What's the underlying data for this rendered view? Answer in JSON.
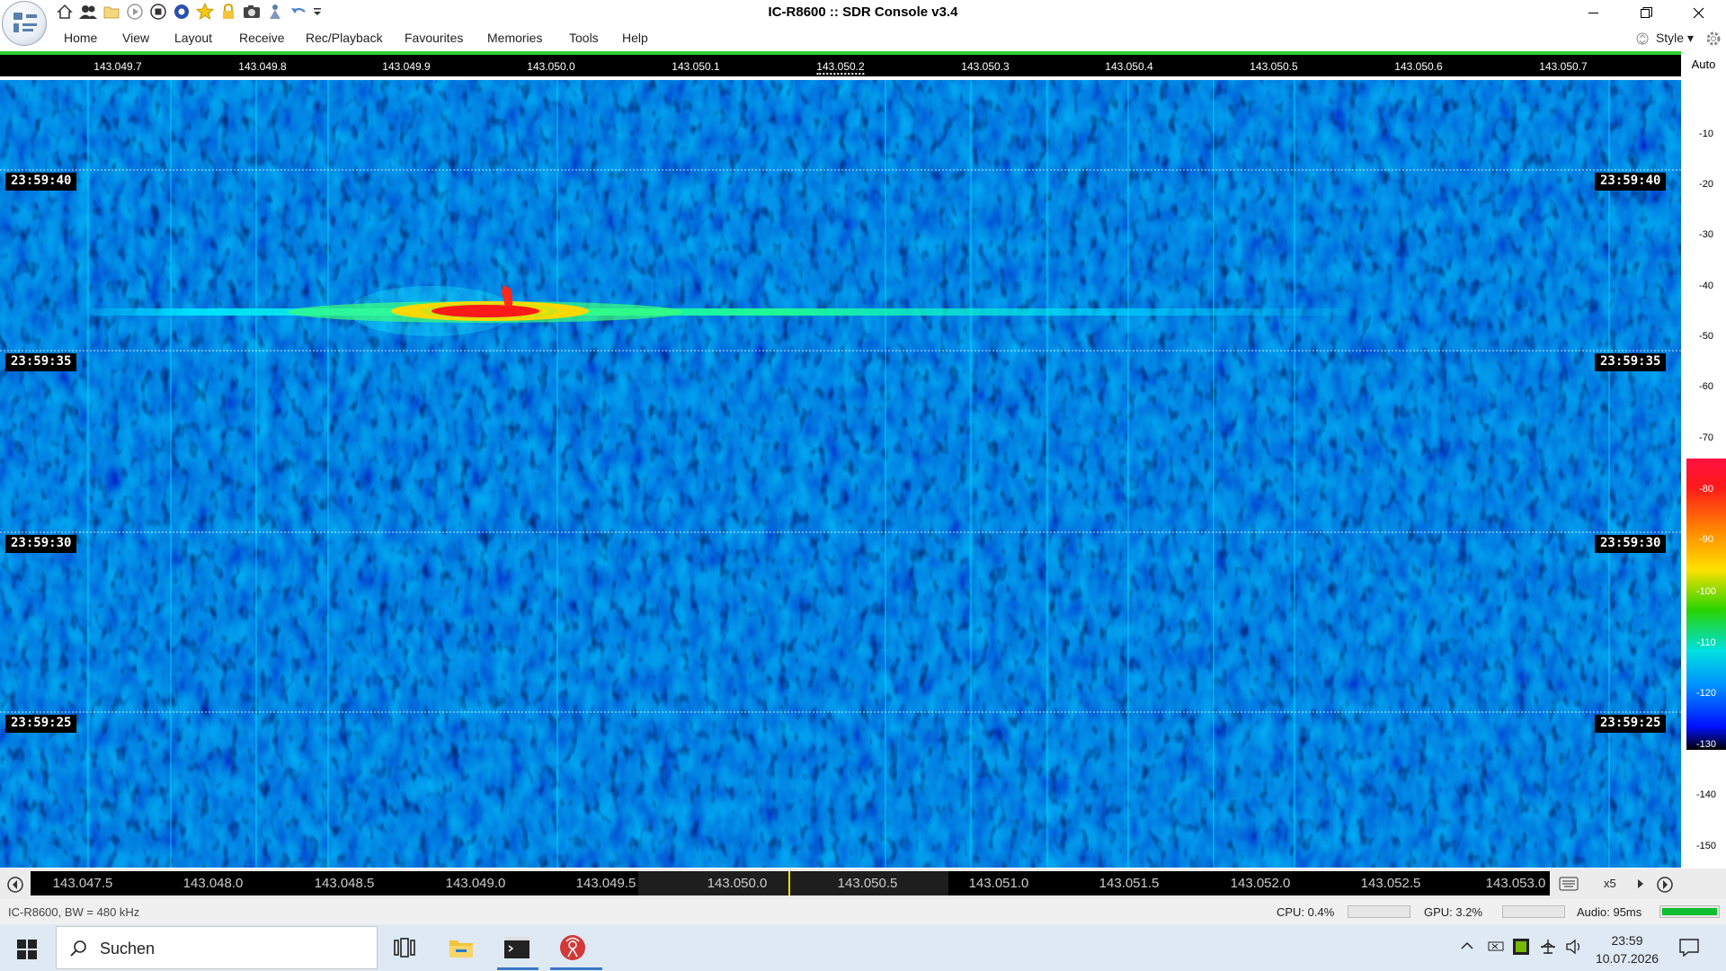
{
  "window": {
    "title": "IC-R8600 :: SDR Console v3.4"
  },
  "menu": {
    "items": [
      "Home",
      "View",
      "Layout",
      "Receive",
      "Rec/Playback",
      "Favourites",
      "Memories",
      "Tools",
      "Help"
    ],
    "style_label": "Style"
  },
  "quick_access": [
    "home-icon",
    "users-icon",
    "open-folder-icon",
    "play-icon",
    "stop-icon",
    "record-icon",
    "favourite-star-icon",
    "lock-icon",
    "camera-icon",
    "antenna-icon",
    "undo-icon",
    "customize-dropdown-icon"
  ],
  "spectrum": {
    "auto_label": "Auto",
    "top_scale": [
      "143.049.7",
      "143.049.8",
      "143.049.9",
      "143.050.0",
      "143.050.1",
      "143.050.2",
      "143.050.3",
      "143.050.4",
      "143.050.5",
      "143.050.6",
      "143.050.7"
    ],
    "time_marks": [
      "23:59:40",
      "23:59:35",
      "23:59:30",
      "23:59:25"
    ],
    "db_labels": [
      "-10",
      "-20",
      "-30",
      "-40",
      "-50",
      "-60",
      "-70",
      "-80",
      "-90",
      "-100",
      "-110",
      "-120",
      "-130",
      "-140",
      "-150"
    ],
    "bottom_scale": [
      "143.047.5",
      "143.048.0",
      "143.048.5",
      "143.049.0",
      "143.049.5",
      "143.050.0",
      "143.050.5",
      "143.051.0",
      "143.051.5",
      "143.052.0",
      "143.052.5",
      "143.053.0"
    ],
    "zoom_label": "x5",
    "colors": {
      "background": "#0f2fd8",
      "trace": "#00e8ff",
      "peak": "#ff1a1a"
    }
  },
  "status": {
    "left": "IC-R8600, BW = 480 kHz",
    "cpu": "CPU: 0.4%",
    "gpu": "GPU: 3.2%",
    "audio": "Audio: 95ms",
    "audio_level": 1.0
  },
  "taskbar": {
    "search_placeholder": "Suchen",
    "time": "23:59",
    "date": "10.07.2026"
  }
}
